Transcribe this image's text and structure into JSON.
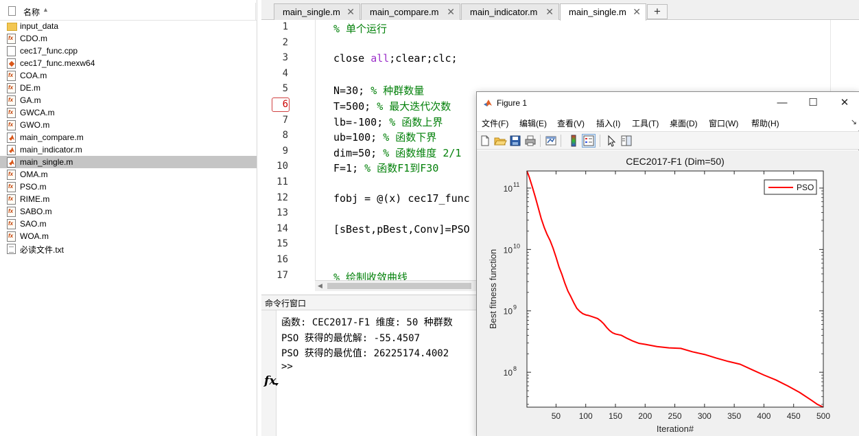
{
  "files": {
    "header": "名称",
    "items": [
      {
        "name": "input_data",
        "icon": "folder-icon",
        "selected": false
      },
      {
        "name": "CDO.m",
        "icon": "m-file-icon",
        "selected": false
      },
      {
        "name": "cec17_func.cpp",
        "icon": "cpp-file-icon",
        "selected": false
      },
      {
        "name": "cec17_func.mexw64",
        "icon": "mex-file-icon",
        "selected": false
      },
      {
        "name": "COA.m",
        "icon": "m-file-icon",
        "selected": false
      },
      {
        "name": "DE.m",
        "icon": "m-file-icon",
        "selected": false
      },
      {
        "name": "GA.m",
        "icon": "m-file-icon",
        "selected": false
      },
      {
        "name": "GWCA.m",
        "icon": "m-file-icon",
        "selected": false
      },
      {
        "name": "GWO.m",
        "icon": "m-file-icon",
        "selected": false
      },
      {
        "name": "main_compare.m",
        "icon": "script-file-icon",
        "selected": false
      },
      {
        "name": "main_indicator.m",
        "icon": "script-file-icon",
        "selected": false
      },
      {
        "name": "main_single.m",
        "icon": "script-file-icon",
        "selected": true
      },
      {
        "name": "OMA.m",
        "icon": "m-file-icon",
        "selected": false
      },
      {
        "name": "PSO.m",
        "icon": "m-file-icon",
        "selected": false
      },
      {
        "name": "RIME.m",
        "icon": "m-file-icon",
        "selected": false
      },
      {
        "name": "SABO.m",
        "icon": "m-file-icon",
        "selected": false
      },
      {
        "name": "SAO.m",
        "icon": "m-file-icon",
        "selected": false
      },
      {
        "name": "WOA.m",
        "icon": "m-file-icon",
        "selected": false
      },
      {
        "name": "必读文件.txt",
        "icon": "txt-file-icon",
        "selected": false
      }
    ]
  },
  "editor": {
    "tabs": [
      {
        "label": "main_single.m",
        "active": false
      },
      {
        "label": "main_compare.m",
        "active": false
      },
      {
        "label": "main_indicator.m",
        "active": false
      },
      {
        "label": "main_single.m",
        "active": true
      }
    ],
    "close_glyph": "✕",
    "add_glyph": "+",
    "breakpoint_line": 6,
    "lines": [
      {
        "n": "1",
        "parts": [
          {
            "t": "% 单个运行",
            "c": "comment"
          }
        ]
      },
      {
        "n": "2",
        "parts": []
      },
      {
        "n": "3",
        "parts": [
          {
            "t": "close ",
            "c": "plain"
          },
          {
            "t": "all",
            "c": "kw"
          },
          {
            "t": ";clear;clc;",
            "c": "plain"
          }
        ]
      },
      {
        "n": "4",
        "parts": []
      },
      {
        "n": "5",
        "parts": [
          {
            "t": "N=30; ",
            "c": "plain"
          },
          {
            "t": "% 种群数量",
            "c": "comment"
          }
        ]
      },
      {
        "n": "6",
        "parts": [
          {
            "t": "T=500; ",
            "c": "plain"
          },
          {
            "t": "% 最大迭代次数",
            "c": "comment"
          }
        ]
      },
      {
        "n": "7",
        "parts": [
          {
            "t": "lb=-100; ",
            "c": "plain"
          },
          {
            "t": "% 函数上界",
            "c": "comment"
          }
        ]
      },
      {
        "n": "8",
        "parts": [
          {
            "t": "ub=100; ",
            "c": "plain"
          },
          {
            "t": "% 函数下界",
            "c": "comment"
          }
        ]
      },
      {
        "n": "9",
        "parts": [
          {
            "t": "dim=50; ",
            "c": "plain"
          },
          {
            "t": "% 函数维度 2/1",
            "c": "comment"
          }
        ]
      },
      {
        "n": "10",
        "parts": [
          {
            "t": "F=1; ",
            "c": "plain"
          },
          {
            "t": "% 函数F1到F30",
            "c": "comment"
          }
        ]
      },
      {
        "n": "11",
        "parts": []
      },
      {
        "n": "12",
        "parts": [
          {
            "t": "fobj = @(x) cec17_func",
            "c": "plain"
          }
        ]
      },
      {
        "n": "13",
        "parts": []
      },
      {
        "n": "14",
        "parts": [
          {
            "t": "[sBest,pBest,Conv]=PSO",
            "c": "plain"
          }
        ]
      },
      {
        "n": "15",
        "parts": []
      },
      {
        "n": "16",
        "parts": []
      },
      {
        "n": "17",
        "parts": [
          {
            "t": "% 绘制收敛曲线",
            "c": "comment"
          }
        ]
      }
    ]
  },
  "command": {
    "title": "命令行窗口",
    "lines": [
      "函数: CEC2017-F1 维度: 50 种群数",
      "PSO 获得的最优解: -55.4507",
      "PSO 获得的最优值: 26225174.4002"
    ],
    "fx_label": "fx",
    "prompt": ">>"
  },
  "figure": {
    "title": "Figure 1",
    "window_buttons": {
      "minimize": "—",
      "maximize": "☐",
      "close": "✕"
    },
    "menus": [
      "文件(F)",
      "编辑(E)",
      "查看(V)",
      "插入(I)",
      "工具(T)",
      "桌面(D)",
      "窗口(W)",
      "帮助(H)"
    ],
    "menu_overflow": "↘",
    "toolbar": [
      {
        "name": "new-figure-icon",
        "active": false
      },
      {
        "name": "open-file-icon",
        "active": false
      },
      {
        "name": "save-icon",
        "active": false
      },
      {
        "name": "print-icon",
        "active": false
      },
      {
        "name": "link-plot-icon",
        "active": false
      },
      {
        "name": "colorbar-icon",
        "active": false
      },
      {
        "name": "legend-icon",
        "active": true
      },
      {
        "name": "edit-plot-icon",
        "active": false
      },
      {
        "name": "property-inspector-icon",
        "active": false
      }
    ]
  },
  "chart_data": {
    "type": "line",
    "title": "CEC2017-F1 (Dim=50)",
    "xlabel": "Iteration#",
    "ylabel": "Best fitness function",
    "xlim": [
      1,
      500
    ],
    "ylim": [
      27000000,
      190000000000
    ],
    "yscale": "log",
    "xticks": [
      50,
      100,
      150,
      200,
      250,
      300,
      350,
      400,
      450,
      500
    ],
    "yticks": [
      100000000,
      1000000000,
      10000000000,
      100000000000
    ],
    "ytick_labels": [
      {
        "base": "10",
        "exp": "8"
      },
      {
        "base": "10",
        "exp": "9"
      },
      {
        "base": "10",
        "exp": "10"
      },
      {
        "base": "10",
        "exp": "11"
      }
    ],
    "grid": false,
    "legend": "top-right",
    "series": [
      {
        "name": "PSO",
        "color": "#ff0000",
        "x": [
          1,
          5,
          10,
          15,
          20,
          25,
          30,
          35,
          40,
          45,
          50,
          55,
          60,
          65,
          70,
          75,
          80,
          85,
          90,
          95,
          100,
          105,
          110,
          115,
          120,
          125,
          130,
          135,
          140,
          145,
          150,
          160,
          170,
          180,
          190,
          200,
          220,
          240,
          260,
          280,
          300,
          320,
          340,
          360,
          380,
          400,
          420,
          440,
          460,
          480,
          490,
          500
        ],
        "y": [
          190000000000,
          150000000000,
          105000000000,
          72000000000,
          48000000000,
          32000000000,
          23000000000,
          17500000000,
          14000000000,
          10500000000,
          7500000000,
          5200000000,
          3900000000,
          2800000000,
          2100000000,
          1700000000,
          1350000000,
          1100000000,
          980000000,
          900000000,
          860000000,
          840000000,
          810000000,
          780000000,
          750000000,
          690000000,
          620000000,
          540000000,
          480000000,
          440000000,
          420000000,
          400000000,
          355000000,
          320000000,
          295000000,
          285000000,
          262000000,
          250000000,
          245000000,
          215000000,
          195000000,
          170000000,
          150000000,
          135000000,
          110000000,
          90000000,
          75000000,
          60000000,
          47000000,
          35000000,
          30000000,
          27000000
        ]
      }
    ]
  }
}
